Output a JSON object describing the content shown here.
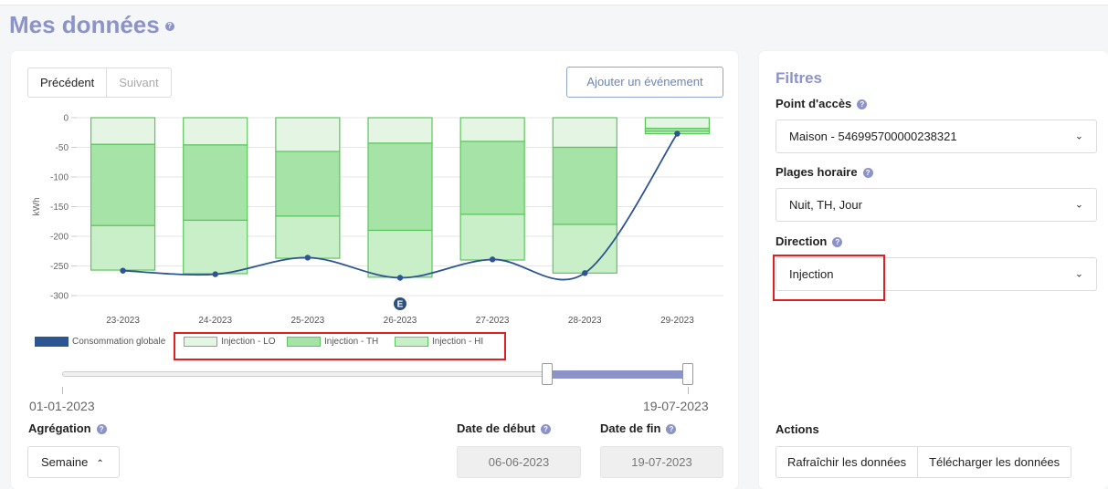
{
  "page": {
    "title": "Mes données"
  },
  "nav": {
    "prev": "Précédent",
    "next": "Suivant",
    "add_event": "Ajouter un événement"
  },
  "chart_data": {
    "type": "bar",
    "ylabel": "kWh",
    "xlabel": "",
    "ylim": [
      -300,
      0
    ],
    "yticks": [
      0,
      -50,
      -100,
      -150,
      -200,
      -250,
      -300
    ],
    "categories": [
      "23-2023",
      "24-2023",
      "25-2023",
      "26-2023",
      "27-2023",
      "28-2023",
      "29-2023"
    ],
    "series": [
      {
        "name": "Injection - LO",
        "type": "bar",
        "stack": true,
        "color": "#e4f5e4",
        "values": [
          -45,
          -46,
          -57,
          -43,
          -40,
          -50,
          -18
        ]
      },
      {
        "name": "Injection - TH",
        "type": "bar",
        "stack": true,
        "color": "#a6e3a6",
        "values": [
          -137,
          -127,
          -109,
          -147,
          -123,
          -130,
          -5
        ]
      },
      {
        "name": "Injection - HI",
        "type": "bar",
        "stack": true,
        "color": "#c9efc9",
        "values": [
          -75,
          -90,
          -71,
          -79,
          -77,
          -82,
          -4
        ]
      },
      {
        "name": "Consommation globale",
        "type": "line",
        "color": "#2c5591",
        "values": [
          -258,
          -264,
          -236,
          -270,
          -239,
          -262,
          -27
        ]
      }
    ],
    "event_marker": {
      "category": "26-2023",
      "label": "E"
    },
    "legend": "bottom-left",
    "grid": true
  },
  "slider": {
    "start_label": "01-01-2023",
    "end_label": "19-07-2023",
    "selected_from": 0.78,
    "selected_to": 1.0
  },
  "aggregation": {
    "label": "Agrégation",
    "value": "Semaine"
  },
  "dates": {
    "start_label": "Date de début",
    "start_value": "06-06-2023",
    "end_label": "Date de fin",
    "end_value": "19-07-2023"
  },
  "filters": {
    "title": "Filtres",
    "access_point": {
      "label": "Point d'accès",
      "value": "Maison - 546995700000238321"
    },
    "time_ranges": {
      "label": "Plages horaire",
      "value": "Nuit, TH, Jour"
    },
    "direction": {
      "label": "Direction",
      "value": "Injection"
    }
  },
  "actions": {
    "label": "Actions",
    "refresh": "Rafraîchir les données",
    "download": "Télécharger les données"
  },
  "icons": {
    "help": "?",
    "chevron_down": "❯",
    "chevron_up": "⌃"
  }
}
